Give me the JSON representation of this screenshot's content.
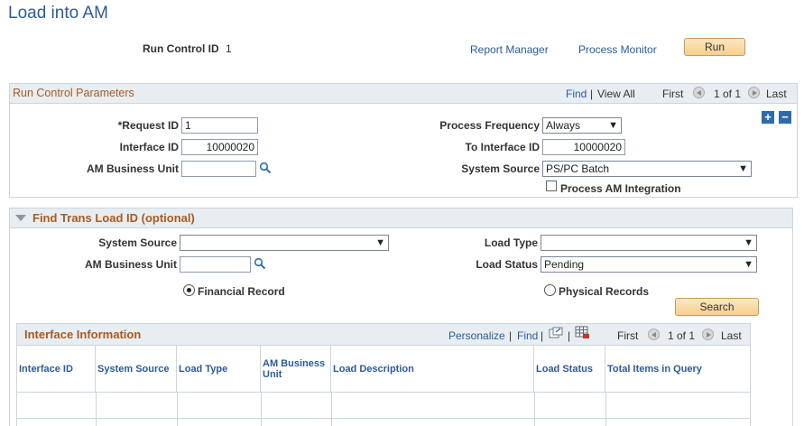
{
  "page": {
    "title": "Load into AM",
    "run_control_label": "Run Control ID",
    "run_control_value": "1",
    "report_manager": "Report Manager",
    "process_monitor": "Process Monitor",
    "run_button": "Run"
  },
  "run_control_params": {
    "title": "Run Control Parameters",
    "find": "Find",
    "view_all": "View All",
    "first": "First",
    "count": "1 of 1",
    "last": "Last",
    "request_id_label": "*Request ID",
    "request_id_value": "1",
    "interface_id_label": "Interface ID",
    "interface_id_value": "10000020",
    "am_business_unit_label": "AM Business Unit",
    "am_business_unit_value": "",
    "process_frequency_label": "Process Frequency",
    "process_frequency_value": "Always",
    "to_interface_id_label": "To Interface ID",
    "to_interface_id_value": "10000020",
    "system_source_label": "System Source",
    "system_source_value": "PS/PC Batch",
    "process_am_integration_label": "Process AM Integration"
  },
  "find_trans": {
    "title": "Find Trans Load ID (optional)",
    "system_source_label": "System Source",
    "system_source_value": "",
    "am_business_unit_label": "AM Business Unit",
    "am_business_unit_value": "",
    "load_type_label": "Load Type",
    "load_type_value": "",
    "load_status_label": "Load Status",
    "load_status_value": "Pending",
    "financial_record_label": "Financial Record",
    "physical_records_label": "Physical Records",
    "search_button": "Search"
  },
  "interface_info": {
    "title": "Interface Information",
    "personalize": "Personalize",
    "find": "Find",
    "first": "First",
    "count": "1 of 1",
    "last": "Last",
    "columns": [
      "Interface ID",
      "System Source",
      "Load Type",
      "AM Business Unit",
      "Load Description",
      "Load Status",
      "Total Items in Query"
    ]
  },
  "colors": {
    "title_blue": "#2d5b97",
    "section_orange": "#a85b1f",
    "header_bg": "#e8edf2"
  }
}
